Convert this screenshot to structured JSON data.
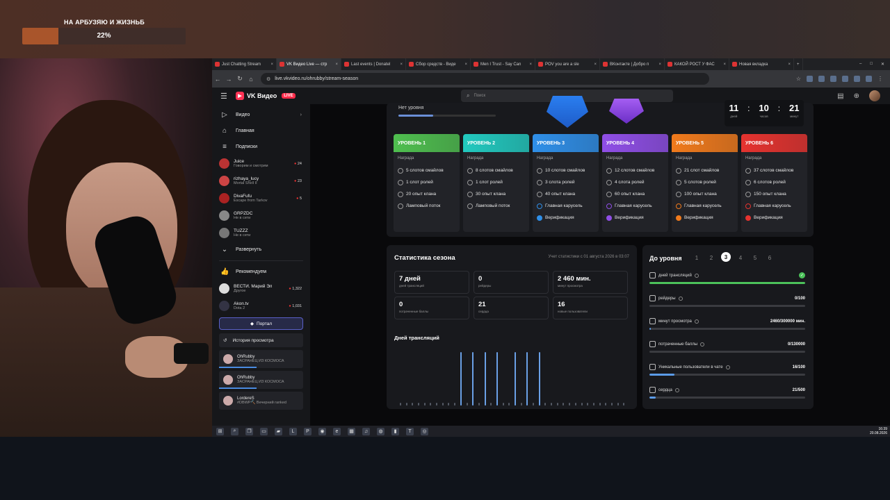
{
  "overlay": {
    "goal_title": "НА АРБУЗЯЮ И ЖИЗНЬБ",
    "goal_percent": "22%",
    "goal_progress": 0.22
  },
  "browser": {
    "tabs": [
      {
        "label": "Just Chatting Stream",
        "active": false
      },
      {
        "label": "VK Видео Live — стр",
        "active": true
      },
      {
        "label": "Last events | Donatel",
        "active": false
      },
      {
        "label": "Сбор средств - Виде",
        "active": false
      },
      {
        "label": "Men I Trust - Say Can",
        "active": false
      },
      {
        "label": "POV you are a sle",
        "active": false
      },
      {
        "label": "ВКонтакте | Добро п",
        "active": false
      },
      {
        "label": "КАКОЙ РОСТ У ФАС",
        "active": false
      },
      {
        "label": "Новая вкладка",
        "active": false
      }
    ],
    "url": "live.vkvideo.ru/ohrubby/stream-season"
  },
  "header": {
    "logo": "VK Видео",
    "live_badge": "LIVE",
    "search_placeholder": "Поиск"
  },
  "sidebar": {
    "nav": [
      {
        "label": "Видео",
        "icon": "play-icon"
      },
      {
        "label": "Главная",
        "icon": "home-icon"
      },
      {
        "label": "Подписки",
        "icon": "subscriptions-icon"
      }
    ],
    "subs": [
      {
        "name": "Juice",
        "status": "Говорим и смотрим",
        "count": "24"
      },
      {
        "name": "rizhaya_lucy",
        "status": "Mortal Shell II",
        "count": "23"
      },
      {
        "name": "DivaFufu",
        "status": "Escape from Tarkov",
        "count": "5"
      },
      {
        "name": "GRPZDC",
        "status": "Не в сети",
        "count": ""
      },
      {
        "name": "TUZZZ",
        "status": "Не в сети",
        "count": ""
      }
    ],
    "expand": "Развернуть",
    "recommend": "Рекомендуем",
    "recs": [
      {
        "name": "ВЕСТИ. Марий Эл",
        "status": "Другое",
        "count": "1,322"
      },
      {
        "name": "Akon.tv",
        "status": "Dota 2",
        "count": "1,031"
      }
    ],
    "portal": "Портал",
    "history": "История просмотра",
    "history_items": [
      {
        "name": "OhRubby",
        "status": "ЗАСРАНЕЦ ИЗ КОСМОСА",
        "progress": 0.45
      },
      {
        "name": "OhRubby",
        "status": "ЗАСРАНЕЦ ИЗ КОСМОСА",
        "progress": 0.45
      },
      {
        "name": "LordereS",
        "status": "#DBWP⛏️ Вечерний ranked",
        "progress": 0
      }
    ]
  },
  "season": {
    "no_level": "Нет уровня",
    "timer": {
      "days": "11",
      "hours": "10",
      "minutes": "21",
      "days_label": "дней",
      "hours_label": "часов",
      "minutes_label": "минут"
    },
    "reward_label": "Награда",
    "levels": [
      {
        "title": "УРОВЕНЬ 1",
        "color": "#4fbf4f",
        "perks": [
          "5 слотов смайлов",
          "1 слот ролей",
          "20 опыт клана",
          "Ламповый поток"
        ]
      },
      {
        "title": "УРОВЕНЬ 2",
        "color": "#22c9bf",
        "perks": [
          "8 слотов смайлов",
          "1 слот ролей",
          "30 опыт клана",
          "Ламповый поток"
        ]
      },
      {
        "title": "УРОВЕНЬ 3",
        "color": "#2f8fe8",
        "perks": [
          "10 слотов смайлов",
          "3 слота ролей",
          "40 опыт клана",
          "Главная карусель",
          "Верификация"
        ]
      },
      {
        "title": "УРОВЕНЬ 4",
        "color": "#8f4ee6",
        "perks": [
          "12 слотов смайлов",
          "4 слота ролей",
          "60 опыт клана",
          "Главная карусель",
          "Верификация"
        ]
      },
      {
        "title": "УРОВЕНЬ 5",
        "color": "#f07a1c",
        "perks": [
          "21 слот смайлов",
          "5 слотов ролей",
          "100 опыт клана",
          "Главная карусель",
          "Верификация"
        ]
      },
      {
        "title": "УРОВЕНЬ 6",
        "color": "#e5332f",
        "perks": [
          "37 слотов смайлов",
          "6 слотов ролей",
          "150 опыт клана",
          "Главная карусель",
          "Верификация"
        ]
      }
    ]
  },
  "stats": {
    "title": "Статистика сезона",
    "note": "Учет статистики с 01 августа 2026 в 03:07",
    "cards": [
      {
        "value": "7 дней",
        "label": "дней трансляций"
      },
      {
        "value": "0",
        "label": "рейдеры"
      },
      {
        "value": "2 460 мин.",
        "label": "минут просмотра"
      },
      {
        "value": "0",
        "label": "потраченные баллы"
      },
      {
        "value": "21",
        "label": "сердца"
      },
      {
        "value": "16",
        "label": "новые пользователи"
      }
    ],
    "days_title": "Дней трансляций",
    "days": [
      0,
      0,
      0,
      0,
      0,
      0,
      0,
      0,
      0,
      0,
      1,
      0,
      1,
      0,
      1,
      0,
      1,
      0,
      0,
      1,
      0,
      1,
      0,
      1,
      0,
      0,
      0,
      0,
      0,
      0,
      0,
      0,
      0,
      0,
      0,
      0,
      0,
      0
    ]
  },
  "to_level": {
    "title": "До уровня",
    "levels": [
      "1",
      "2",
      "3",
      "4",
      "5",
      "6"
    ],
    "current": "3",
    "requirements": [
      {
        "label": "дней трансляций",
        "value": "",
        "progress": 1.0,
        "color": "#4cc25a",
        "done": true
      },
      {
        "label": "рейдеры",
        "value": "0/100",
        "progress": 0.0,
        "color": "#5b9be8",
        "done": false
      },
      {
        "label": "минут просмотра",
        "value": "2460/300000 мин.",
        "progress": 0.01,
        "color": "#5b9be8",
        "done": false
      },
      {
        "label": "потраченные баллы",
        "value": "0/130000",
        "progress": 0.0,
        "color": "#5b9be8",
        "done": false
      },
      {
        "label": "Уникальные пользователи в чате",
        "value": "16/100",
        "progress": 0.16,
        "color": "#5b9be8",
        "done": false
      },
      {
        "label": "сердца",
        "value": "21/500",
        "progress": 0.04,
        "color": "#5b9be8",
        "done": false
      }
    ]
  },
  "taskbar": {
    "time": "16:39",
    "date": "20.08.2026"
  }
}
